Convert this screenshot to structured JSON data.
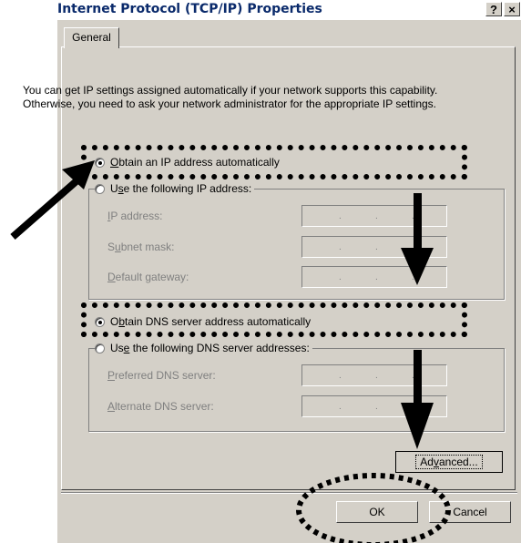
{
  "window": {
    "title": "Internet Protocol (TCP/IP) Properties",
    "help_button": "?",
    "close_button": "×"
  },
  "tabs": [
    {
      "label": "General"
    }
  ],
  "description": "You can get IP settings assigned automatically if your network supports this capability. Otherwise, you need to ask your network administrator for the appropriate IP settings.",
  "ip_section": {
    "auto_option": {
      "pre": "",
      "key": "O",
      "post": "btain an IP address automatically",
      "checked": true
    },
    "manual_option": {
      "pre": "U",
      "key": "s",
      "post": "e the following IP address:",
      "checked": false
    },
    "fields": [
      {
        "pre": "",
        "key": "I",
        "post": "P address:",
        "value": ". . ."
      },
      {
        "pre": "S",
        "key": "u",
        "post": "bnet mask:",
        "value": ". . ."
      },
      {
        "pre": "",
        "key": "D",
        "post": "efault gateway:",
        "value": ". . ."
      }
    ]
  },
  "dns_section": {
    "auto_option": {
      "pre": "O",
      "key": "b",
      "post": "tain DNS server address automatically",
      "checked": true
    },
    "manual_option": {
      "pre": "Us",
      "key": "e",
      "post": " the following DNS server addresses:",
      "checked": false
    },
    "fields": [
      {
        "pre": "",
        "key": "P",
        "post": "referred DNS server:",
        "value": ". . ."
      },
      {
        "pre": "",
        "key": "A",
        "post": "lternate DNS server:",
        "value": ". . ."
      }
    ]
  },
  "buttons": {
    "advanced": {
      "pre": "Ad",
      "key": "v",
      "post": "anced..."
    },
    "ok": "OK",
    "cancel": "Cancel"
  }
}
